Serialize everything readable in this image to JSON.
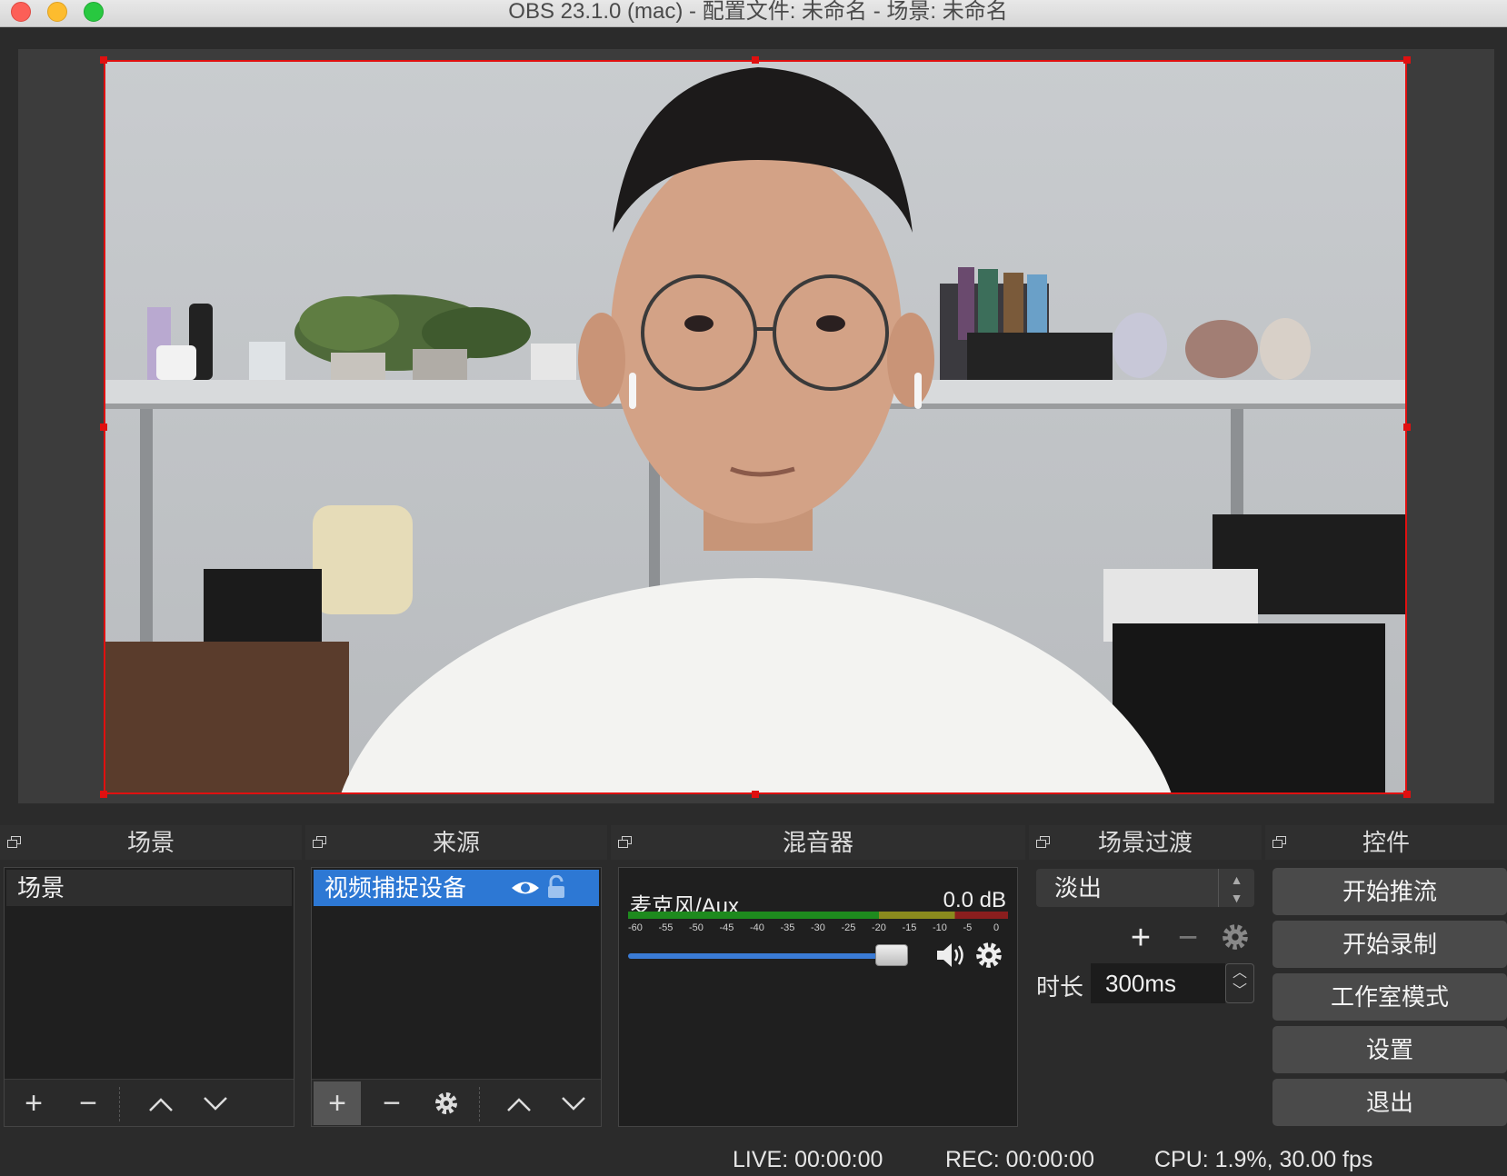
{
  "window": {
    "title": "OBS 23.1.0 (mac) - 配置文件: 未命名 - 场景: 未命名"
  },
  "docks": {
    "scenes": {
      "title": "场景",
      "items": [
        "场景"
      ]
    },
    "sources": {
      "title": "来源",
      "items": [
        "视频捕捉设备"
      ]
    },
    "mixer": {
      "title": "混音器",
      "channel_name": "麦克风/Aux",
      "channel_db": "0.0 dB",
      "meter_scale": [
        "-60",
        "-55",
        "-50",
        "-45",
        "-40",
        "-35",
        "-30",
        "-25",
        "-20",
        "-15",
        "-10",
        "-5",
        "0"
      ],
      "volume_level": 0.88
    },
    "transitions": {
      "title": "场景过渡",
      "selected": "淡出",
      "duration_label": "时长",
      "duration_value": "300ms"
    },
    "controls": {
      "title": "控件",
      "buttons": [
        "开始推流",
        "开始录制",
        "工作室模式",
        "设置",
        "退出"
      ]
    }
  },
  "statusbar": {
    "live": "LIVE: 00:00:00",
    "rec": "REC: 00:00:00",
    "cpu": "CPU: 1.9%, 30.00 fps"
  },
  "colors": {
    "selection": "#e01010",
    "accent": "#2d78d4",
    "panel_bg": "#1f1f1f"
  }
}
